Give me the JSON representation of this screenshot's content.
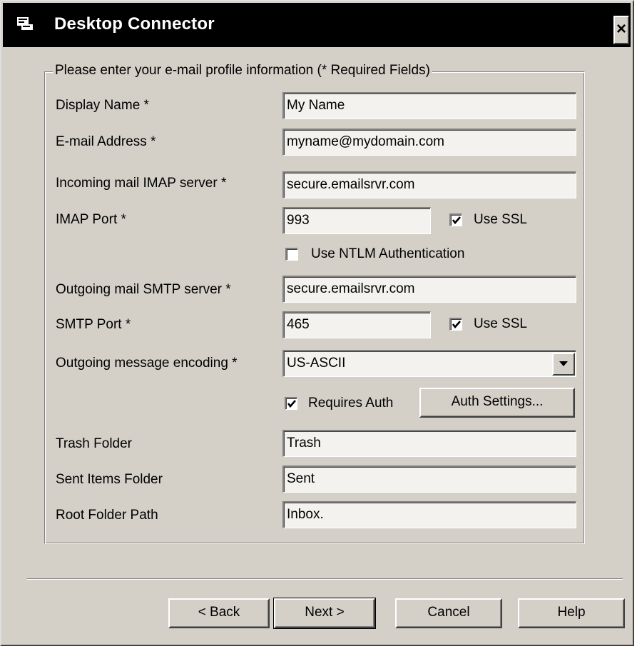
{
  "window": {
    "title": "Desktop Connector",
    "icon": "app-icon",
    "close_label": "×"
  },
  "group": {
    "legend": "Please enter your e-mail profile information (* Required Fields)"
  },
  "fields": {
    "display_name": {
      "label": "Display Name *",
      "value": "My Name"
    },
    "email": {
      "label": "E-mail Address *",
      "value": "myname@mydomain.com"
    },
    "imap_server": {
      "label": "Incoming mail IMAP server *",
      "value": "secure.emailsrvr.com"
    },
    "imap_port": {
      "label": "IMAP Port *",
      "value": "993"
    },
    "imap_ssl": {
      "label": "Use SSL",
      "checked": true
    },
    "ntlm": {
      "label": "Use NTLM Authentication",
      "checked": false
    },
    "smtp_server": {
      "label": "Outgoing mail SMTP server *",
      "value": "secure.emailsrvr.com"
    },
    "smtp_port": {
      "label": "SMTP Port *",
      "value": "465"
    },
    "smtp_ssl": {
      "label": "Use SSL",
      "checked": true
    },
    "encoding": {
      "label": "Outgoing message encoding *",
      "value": "US-ASCII"
    },
    "requires_auth": {
      "label": "Requires Auth",
      "checked": true
    },
    "auth_settings": "Auth Settings...",
    "trash_folder": {
      "label": "Trash Folder",
      "value": "Trash"
    },
    "sent_folder": {
      "label": "Sent Items Folder",
      "value": "Sent"
    },
    "root_path": {
      "label": "Root Folder Path",
      "value": "Inbox."
    }
  },
  "buttons": {
    "back": "< Back",
    "next": "Next >",
    "cancel": "Cancel",
    "help": "Help"
  }
}
